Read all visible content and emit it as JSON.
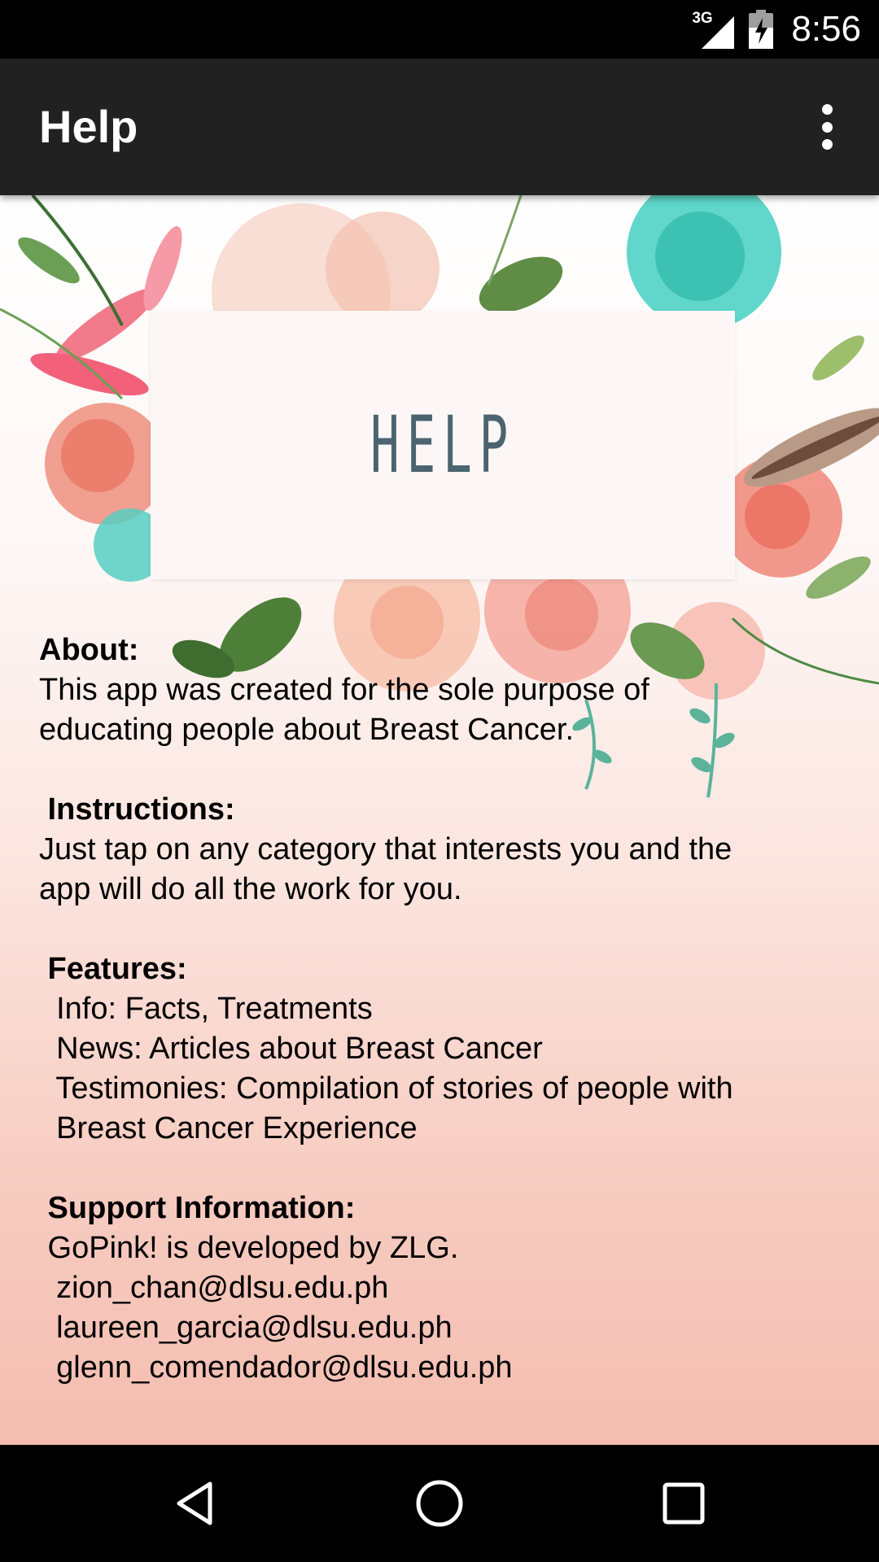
{
  "status_bar": {
    "network": "3G",
    "time": "8:56"
  },
  "app_bar": {
    "title": "Help",
    "menu_icon": "more-vert-icon"
  },
  "banner": {
    "card_text": "HELP"
  },
  "sections": {
    "about": {
      "heading": "About:",
      "lines": [
        "This app was created for the sole purpose of",
        "educating people about Breast Cancer."
      ]
    },
    "instructions": {
      "heading": " Instructions:",
      "lines": [
        "Just tap on any category that interests you and the",
        "app will do all the work for you."
      ]
    },
    "features": {
      "heading": " Features:",
      "lines": [
        "  Info: Facts, Treatments",
        "  News: Articles about Breast Cancer",
        "  Testimonies: Compilation of stories of people with",
        "  Breast Cancer Experience"
      ]
    },
    "support": {
      "heading": " Support Information:",
      "lines": [
        " GoPink! is developed by ZLG.",
        "  zion_chan@dlsu.edu.ph",
        "  laureen_garcia@dlsu.edu.ph",
        "  glenn_comendador@dlsu.edu.ph"
      ]
    }
  },
  "nav_bar": {
    "back_icon": "back-triangle-icon",
    "home_icon": "home-circle-icon",
    "recents_icon": "recents-square-icon"
  },
  "colors": {
    "app_bar": "#212121",
    "status_bar": "#000000",
    "card_text": "#4b6470",
    "background_bottom": "#f4bdb0"
  }
}
